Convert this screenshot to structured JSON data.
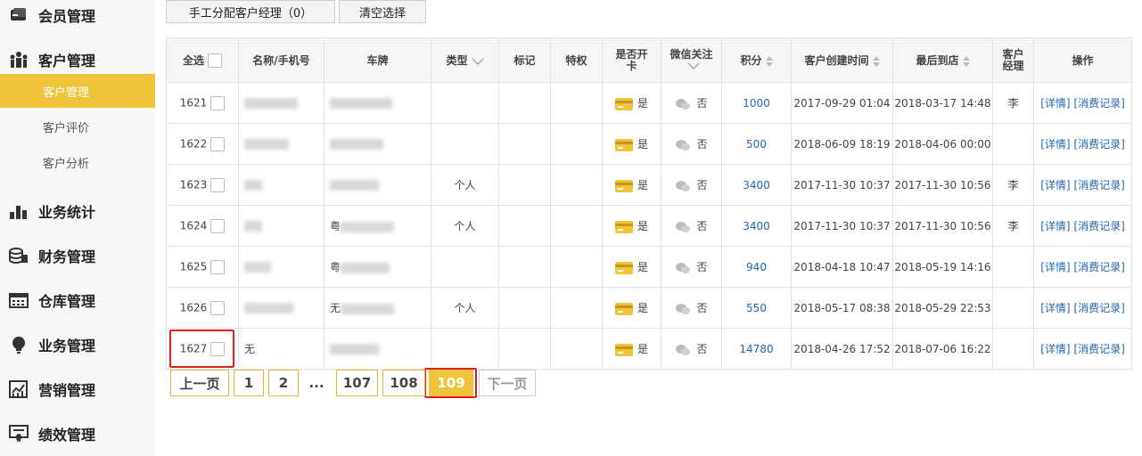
{
  "sidebar": {
    "items": [
      {
        "label": "会员管理",
        "icon": "member-card-icon"
      },
      {
        "label": "客户管理",
        "icon": "people-icon"
      },
      {
        "label": "业务统计",
        "icon": "bar-chart-icon"
      },
      {
        "label": "财务管理",
        "icon": "coins-icon"
      },
      {
        "label": "仓库管理",
        "icon": "warehouse-icon"
      },
      {
        "label": "业务管理",
        "icon": "lightbulb-icon"
      },
      {
        "label": "营销管理",
        "icon": "trend-chart-icon"
      },
      {
        "label": "绩效管理",
        "icon": "certificate-icon"
      }
    ],
    "sub_items": [
      {
        "label": "客户管理",
        "active": true
      },
      {
        "label": "客户评价",
        "active": false
      },
      {
        "label": "客户分析",
        "active": false
      }
    ],
    "active_color": "#f0c43a"
  },
  "toolbar": {
    "assign_label": "手工分配客户经理（0）",
    "clear_label": "清空选择"
  },
  "table": {
    "headers": {
      "select_all": "全选",
      "name": "名称/手机号",
      "plate": "车牌",
      "type": "类型",
      "mark": "标记",
      "privilege": "特权",
      "card": "是否开卡",
      "wechat": "微信关注",
      "points": "积分",
      "created": "客户创建时间",
      "last_visit": "最后到店",
      "manager": "客户经理",
      "ops": "操作"
    },
    "rows": [
      {
        "id": "1621",
        "name": "",
        "plate": "",
        "type": "",
        "card": "是",
        "wechat": "否",
        "points": "1000",
        "created": "2017-09-29 01:04",
        "last": "2018-03-17 14:48",
        "manager": "李"
      },
      {
        "id": "1622",
        "name": "",
        "plate": "",
        "type": "",
        "card": "是",
        "wechat": "否",
        "points": "500",
        "created": "2018-06-09 18:19",
        "last": "2018-04-06 00:00",
        "manager": ""
      },
      {
        "id": "1623",
        "name": "",
        "plate": "",
        "type": "个人",
        "card": "是",
        "wechat": "否",
        "points": "3400",
        "created": "2017-11-30 10:37",
        "last": "2017-11-30 10:56",
        "manager": "李"
      },
      {
        "id": "1624",
        "name": "",
        "plate": "粤",
        "type": "个人",
        "card": "是",
        "wechat": "否",
        "points": "3400",
        "created": "2017-11-30 10:37",
        "last": "2017-11-30 10:56",
        "manager": "李"
      },
      {
        "id": "1625",
        "name": "",
        "plate": "粤",
        "type": "",
        "card": "是",
        "wechat": "否",
        "points": "940",
        "created": "2018-04-18 10:47",
        "last": "2018-05-19 14:16",
        "manager": ""
      },
      {
        "id": "1626",
        "name": "",
        "plate": "无",
        "type": "个人",
        "card": "是",
        "wechat": "否",
        "points": "550",
        "created": "2018-05-17 08:38",
        "last": "2018-05-29 22:53",
        "manager": ""
      },
      {
        "id": "1627",
        "name": "无",
        "plate": "",
        "type": "",
        "card": "是",
        "wechat": "否",
        "points": "14780",
        "created": "2018-04-26 17:52",
        "last": "2018-07-06 16:22",
        "manager": ""
      }
    ],
    "ops": {
      "detail": "[详情]",
      "records": "[消费记录]"
    }
  },
  "pagination": {
    "prev": "上一页",
    "pages": [
      "1",
      "2"
    ],
    "ellipsis": "...",
    "pages_tail": [
      "107",
      "108"
    ],
    "current": "109",
    "next": "下一页"
  },
  "colors": {
    "accent": "#f0c43a",
    "link": "#2266b0",
    "highlight": "#e02020"
  }
}
